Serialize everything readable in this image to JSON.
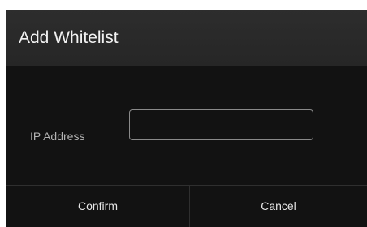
{
  "dialog": {
    "title": "Add Whitelist",
    "field": {
      "label": "IP Address",
      "value": "",
      "placeholder": ""
    },
    "buttons": {
      "confirm_label": "Confirm",
      "cancel_label": "Cancel"
    }
  }
}
